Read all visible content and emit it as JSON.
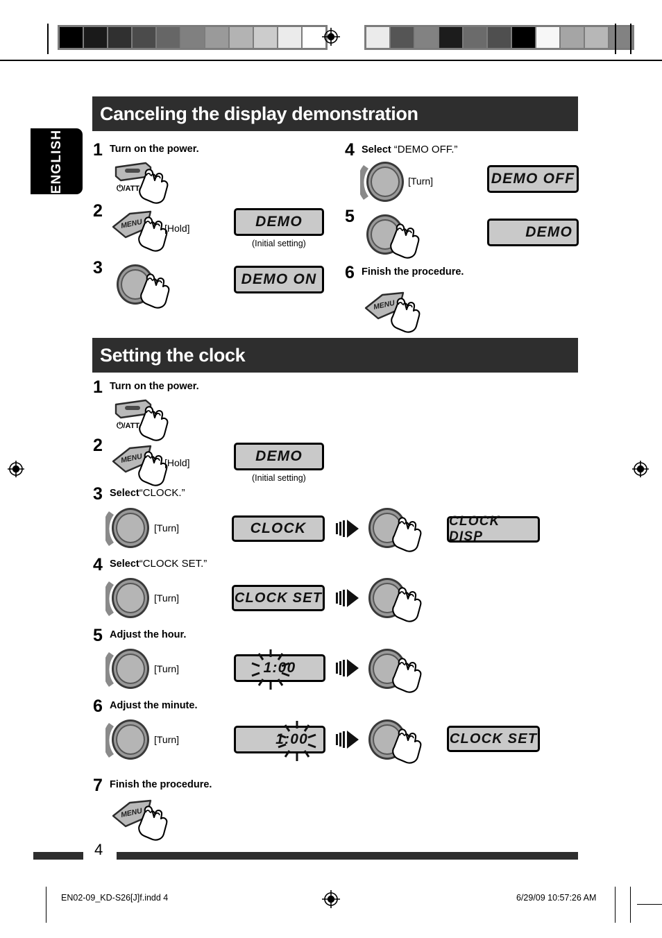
{
  "document": {
    "language_tab": "ENGLISH",
    "page_number": "4",
    "footer_left": "EN02-09_KD-S26[J]f.indd   4",
    "footer_right": "6/29/09   10:57:26 AM"
  },
  "colors": {
    "header_bar": "#2e2e2e",
    "lcd_face": "#c9c9c9",
    "knob_ring": "#999999",
    "knob_inner": "#b5b5b5",
    "page_bar": "#2e2e2e"
  },
  "calibration": {
    "left_swatches": [
      "#000000",
      "#1a1a1a",
      "#303030",
      "#4b4b4b",
      "#666666",
      "#808080",
      "#9a9a9a",
      "#b3b3b3",
      "#cccccc",
      "#ebebeb",
      "#ffffff"
    ],
    "right_swatches": [
      "#ebebeb",
      "#555555",
      "#828282",
      "#1c1c1c",
      "#6b6b6b",
      "#4f4f4f",
      "#000000",
      "#f7f7f7",
      "#a5a5a5",
      "#b7b7b7",
      "#828282"
    ]
  },
  "sections": [
    {
      "title": "Canceling the display demonstration",
      "steps": [
        {
          "num": "1",
          "caption": "Turn on the power.",
          "control": "power-button",
          "control_label": "⏻/ATT"
        },
        {
          "num": "2",
          "caption": "",
          "control": "menu-button",
          "control_label": "MENU",
          "action_tag": "[Hold]",
          "display": "DEMO",
          "display_note": "(Initial setting)"
        },
        {
          "num": "3",
          "caption": "",
          "control": "knob-press",
          "display": "DEMO ON"
        },
        {
          "num": "4",
          "caption": "Select “DEMO OFF.”",
          "control": "knob-turn",
          "action_tag": "[Turn]",
          "display": "DEMO OFF"
        },
        {
          "num": "5",
          "caption": "",
          "control": "knob-press",
          "display": "DEMO"
        },
        {
          "num": "6",
          "caption": "Finish the procedure.",
          "control": "menu-button",
          "control_label": "MENU"
        }
      ]
    },
    {
      "title": "Setting the clock",
      "steps": [
        {
          "num": "1",
          "caption": "Turn on the power.",
          "control": "power-button",
          "control_label": "⏻/ATT"
        },
        {
          "num": "2",
          "caption": "",
          "control": "menu-button",
          "control_label": "MENU",
          "action_tag": "[Hold]",
          "display": "DEMO",
          "display_note": "(Initial setting)"
        },
        {
          "num": "3",
          "caption_bold": "Select",
          "caption_quote": "“CLOCK.”",
          "control": "knob-turn",
          "action_tag": "[Turn]",
          "display": "CLOCK",
          "display2": "CLOCK DISP"
        },
        {
          "num": "4",
          "caption_bold": "Select",
          "caption_quote": "“CLOCK SET.”",
          "control": "knob-turn",
          "action_tag": "[Turn]",
          "display": "CLOCK SET",
          "display2": ""
        },
        {
          "num": "5",
          "caption": "Adjust the hour.",
          "control": "knob-turn",
          "action_tag": "[Turn]",
          "display": "1:00",
          "display_flash": "hour"
        },
        {
          "num": "6",
          "caption": "Adjust the minute.",
          "control": "knob-turn",
          "action_tag": "[Turn]",
          "display": "1:00",
          "display_flash": "minute",
          "display2": "CLOCK SET"
        },
        {
          "num": "7",
          "caption": "Finish the procedure.",
          "control": "menu-button",
          "control_label": "MENU"
        }
      ]
    }
  ],
  "labels": {
    "hold": "[Hold]",
    "turn": "[Turn]",
    "menu": "MENU",
    "power": "/ATT",
    "initial_setting": "(Initial setting)"
  }
}
